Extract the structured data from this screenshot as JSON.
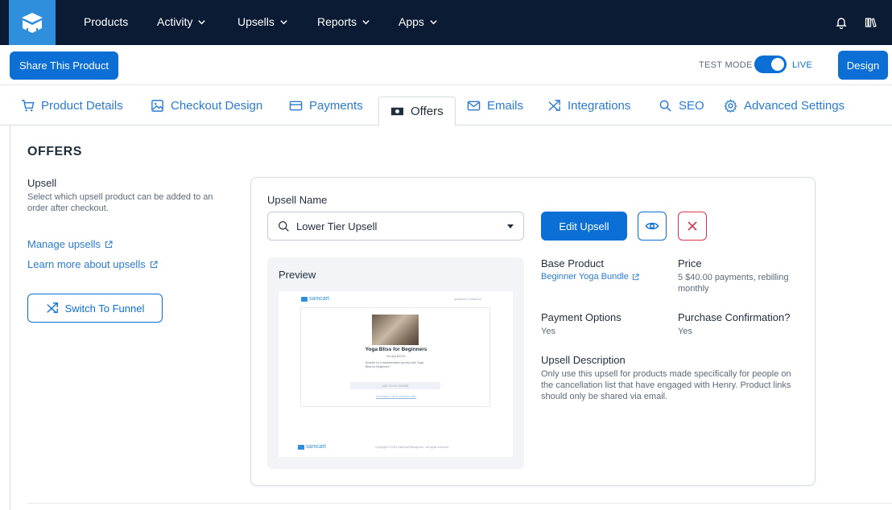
{
  "nav": {
    "items": [
      {
        "label": "Products",
        "dropdown": false
      },
      {
        "label": "Activity",
        "dropdown": true
      },
      {
        "label": "Upsells",
        "dropdown": true
      },
      {
        "label": "Reports",
        "dropdown": true
      },
      {
        "label": "Apps",
        "dropdown": true
      }
    ],
    "right_icons": [
      "bell-icon",
      "library-icon"
    ]
  },
  "toolbar": {
    "share_label": "Share This Product",
    "test_mode_label": "TEST MODE",
    "live_label": "LIVE",
    "live_enabled": true,
    "design_label": "Design"
  },
  "tabs": [
    {
      "label": "Product Details",
      "icon": "cart-icon"
    },
    {
      "label": "Checkout Design",
      "icon": "image-icon"
    },
    {
      "label": "Payments",
      "icon": "credit-card-icon"
    },
    {
      "label": "Offers",
      "icon": "money-icon",
      "active": true
    },
    {
      "label": "Emails",
      "icon": "mail-icon"
    },
    {
      "label": "Integrations",
      "icon": "shuffle-icon"
    },
    {
      "label": "SEO",
      "icon": "search-icon"
    },
    {
      "label": "Advanced Settings",
      "icon": "gear-icon"
    }
  ],
  "page": {
    "title": "OFFERS",
    "upsell_heading": "Upsell",
    "upsell_desc": "Select which upsell product can be added to an order after checkout.",
    "manage_link": "Manage upsells",
    "learn_link": "Learn more about upsells",
    "funnel_button": "Switch To Funnel"
  },
  "card": {
    "upsell_name_label": "Upsell Name",
    "selected_upsell": "Lower Tier Upsell",
    "edit_button": "Edit Upsell",
    "preview_label": "Preview",
    "preview": {
      "brand": "samcart",
      "top_right_text": "questions? contact us",
      "title": "Yoga Bliss for Beginners",
      "price_line": "for only $24.00",
      "desc": "Embark on a transformative journey with 'Yoga Bliss for Beginners'!",
      "button": "ADD TO MY ORDER",
      "decline_link": "No thanks, I don't want this offer",
      "footer_copy": "Copyright © 2024 SamCart Wordpress - All rights reserved."
    },
    "base_product_label": "Base Product",
    "base_product_value": "Beginner Yoga Bundle",
    "price_label": "Price",
    "price_value": "5 $40.00 payments, rebilling monthly",
    "payment_options_label": "Payment Options",
    "payment_options_value": "Yes",
    "purchase_confirmation_label": "Purchase Confirmation?",
    "purchase_confirmation_value": "Yes",
    "upsell_desc_label": "Upsell Description",
    "upsell_desc_value": "Only use this upsell for products made specifically for people on the cancellation list that have engaged with Henry. Product links should only be shared via email."
  },
  "colors": {
    "nav_bg": "#0b1b33",
    "accent": "#0b6fd6",
    "link": "#2a7ad1",
    "danger": "#d63a4a",
    "logo_bg": "#2f8fdc"
  }
}
